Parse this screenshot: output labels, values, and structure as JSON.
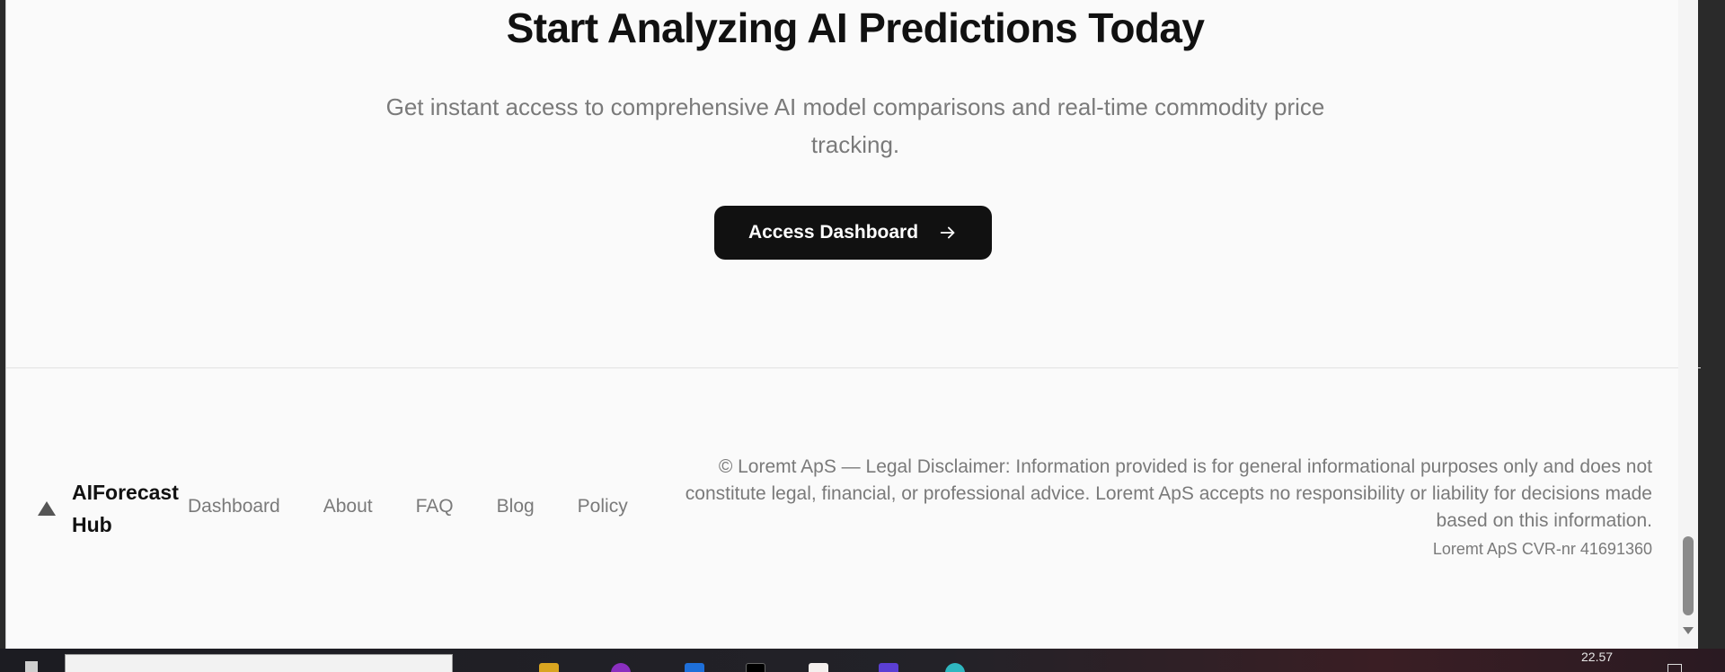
{
  "cta": {
    "title": "Start Analyzing AI Predictions Today",
    "subtitle": "Get instant access to comprehensive AI model comparisons and real-time commodity price tracking.",
    "button_label": "Access Dashboard",
    "button_icon": "arrow-right-icon"
  },
  "footer": {
    "brand": "AIForecast Hub",
    "brand_icon": "triangle-logo-icon",
    "nav": [
      "Dashboard",
      "About",
      "FAQ",
      "Blog",
      "Policy"
    ],
    "legal": "© Loremt ApS — Legal Disclaimer: Information provided is for general informational purposes only and does not constitute legal, financial, or professional advice. Loremt ApS accepts no responsibility or liability for decisions made based on this information.",
    "cvr": "Loremt ApS CVR-nr 41691360"
  },
  "taskbar": {
    "clock": "22.57"
  },
  "colors": {
    "button_bg": "#111111",
    "muted_text": "#7a7a7a",
    "page_bg": "#fafafa"
  }
}
